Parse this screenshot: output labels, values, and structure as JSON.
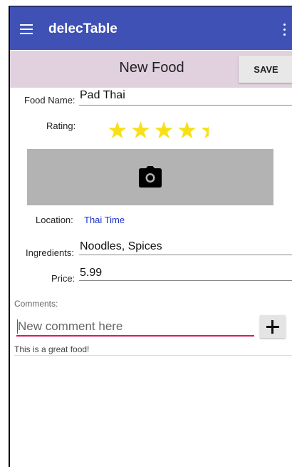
{
  "appbar": {
    "title": "delecTable",
    "menu_icon": "hamburger-menu-icon",
    "overflow_icon": "more-vert-icon",
    "color": "#3f51b5"
  },
  "subbar": {
    "title": "New Food",
    "save_label": "SAVE",
    "color": "#e1d0de"
  },
  "form": {
    "food_name_label": "Food Name:",
    "food_name_value": "Pad Thai",
    "rating_label": "Rating:",
    "rating": 4.5,
    "rating_max": 5,
    "photo_icon": "camera-icon",
    "location_label": "Location:",
    "location_value": "Thai Time",
    "ingredients_label": "Ingredients:",
    "ingredients_value": "Noodles, Spices",
    "price_label": "Price:",
    "price_value": "5.99"
  },
  "comments": {
    "label": "Comments:",
    "input_placeholder": "New comment here",
    "add_icon": "plus-icon",
    "items": [
      "This is a great food!"
    ]
  }
}
